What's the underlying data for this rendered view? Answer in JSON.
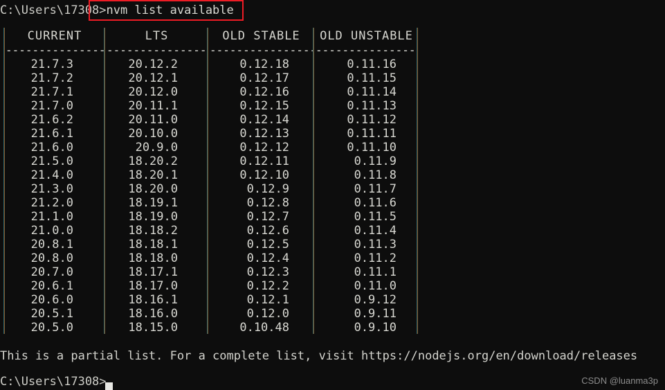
{
  "terminal": {
    "prompt": "C:\\Users\\17308>",
    "command": "nvm list available",
    "footer_note": "This is a partial list. For a complete list, visit https://nodejs.org/en/download/releases",
    "final_prompt": "C:\\Users\\17308>",
    "watermark": "CSDN @luanma3p",
    "background_color": "#0d0d0d",
    "text_color": "#d4d4d4",
    "annotation_color": "#ee1c25"
  },
  "table": {
    "rule": "----------------",
    "columns": [
      {
        "header": "CURRENT",
        "values": [
          "21.7.3",
          "21.7.2",
          "21.7.1",
          "21.7.0",
          "21.6.2",
          "21.6.1",
          "21.6.0",
          "21.5.0",
          "21.4.0",
          "21.3.0",
          "21.2.0",
          "21.1.0",
          "21.0.0",
          "20.8.1",
          "20.8.0",
          "20.7.0",
          "20.6.1",
          "20.6.0",
          "20.5.1",
          "20.5.0"
        ]
      },
      {
        "header": "LTS",
        "values": [
          "20.12.2",
          "20.12.1",
          "20.12.0",
          "20.11.1",
          "20.11.0",
          "20.10.0",
          "20.9.0",
          "18.20.2",
          "18.20.1",
          "18.20.0",
          "18.19.1",
          "18.19.0",
          "18.18.2",
          "18.18.1",
          "18.18.0",
          "18.17.1",
          "18.17.0",
          "18.16.1",
          "18.16.0",
          "18.15.0"
        ]
      },
      {
        "header": "OLD STABLE",
        "values": [
          "0.12.18",
          "0.12.17",
          "0.12.16",
          "0.12.15",
          "0.12.14",
          "0.12.13",
          "0.12.12",
          "0.12.11",
          "0.12.10",
          "0.12.9",
          "0.12.8",
          "0.12.7",
          "0.12.6",
          "0.12.5",
          "0.12.4",
          "0.12.3",
          "0.12.2",
          "0.12.1",
          "0.12.0",
          "0.10.48"
        ]
      },
      {
        "header": "OLD UNSTABLE",
        "values": [
          "0.11.16",
          "0.11.15",
          "0.11.14",
          "0.11.13",
          "0.11.12",
          "0.11.11",
          "0.11.10",
          "0.11.9",
          "0.11.8",
          "0.11.7",
          "0.11.6",
          "0.11.5",
          "0.11.4",
          "0.11.3",
          "0.11.2",
          "0.11.1",
          "0.11.0",
          "0.9.12",
          "0.9.11",
          "0.9.10"
        ]
      }
    ]
  }
}
